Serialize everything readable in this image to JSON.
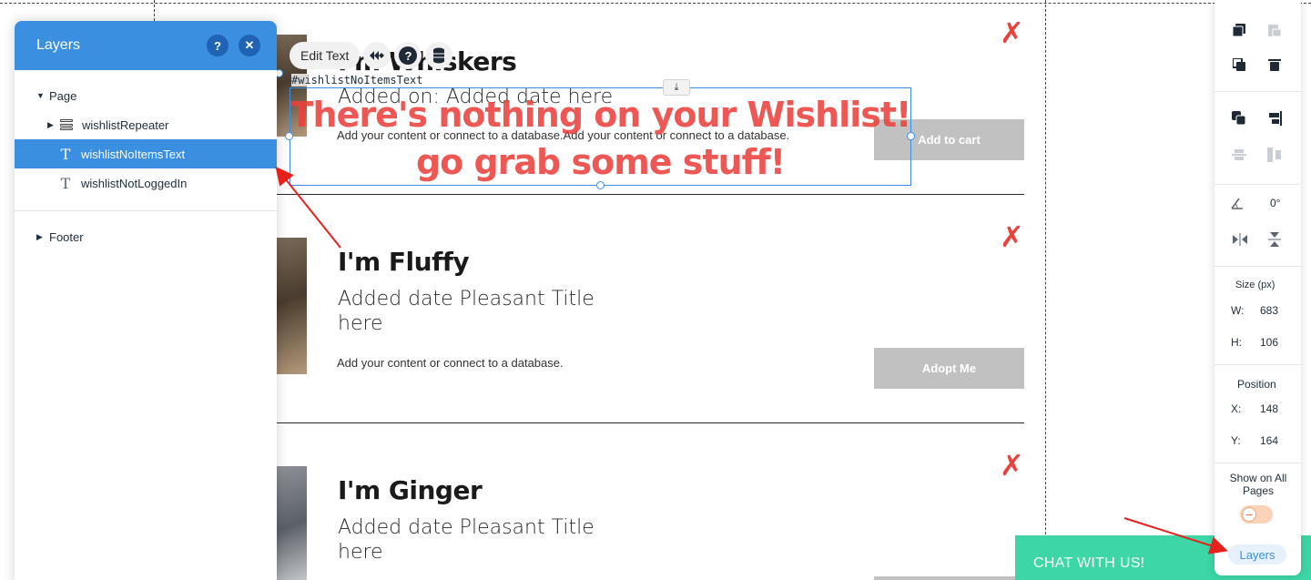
{
  "layers_panel": {
    "title": "Layers",
    "help_label": "?",
    "close_label": "✕",
    "items": [
      {
        "label": "Page"
      },
      {
        "label": "wishlistRepeater"
      },
      {
        "label": "wishlistNoItemsText"
      },
      {
        "label": "wishlistNotLoggedIn"
      },
      {
        "label": "Footer"
      }
    ]
  },
  "toolbar": {
    "edit_text_label": "Edit Text"
  },
  "selection": {
    "element_id": "#wishlistNoItemsText",
    "text": "There's nothing on your Wishlist! go grab some stuff!"
  },
  "repeater_items": [
    {
      "title": "I'm Whiskers",
      "date": "Added on:   Added date here",
      "description": "Add your content or connect to a database.Add your content or connect to a database.",
      "button": "Add to cart",
      "remove": "✗"
    },
    {
      "title": "I'm Fluffy",
      "date": "Added date Pleasant Title here",
      "description": "Add your content or connect to a database.",
      "button": "Adopt Me",
      "remove": "✗"
    },
    {
      "title": "I'm Ginger",
      "date": "Added date Pleasant Title here",
      "description": "",
      "button": "",
      "remove": "✗"
    }
  ],
  "right_toolbar": {
    "rotation_value": "0°",
    "size_label": "Size (px)",
    "width_label": "W:",
    "width_value": "683",
    "height_label": "H:",
    "height_value": "106",
    "position_label": "Position",
    "x_label": "X:",
    "x_value": "148",
    "y_label": "Y:",
    "y_value": "164",
    "show_on_all_pages_label": "Show on All Pages",
    "show_on_all_pages": false,
    "layers_button": "Layers"
  },
  "chat_banner": {
    "label": "CHAT WITH US!"
  },
  "colors": {
    "accent": "#3b8fe0",
    "headline_red": "#eb403c",
    "chat_green": "#3dd6a6",
    "button_gray": "#c1c1c1"
  }
}
